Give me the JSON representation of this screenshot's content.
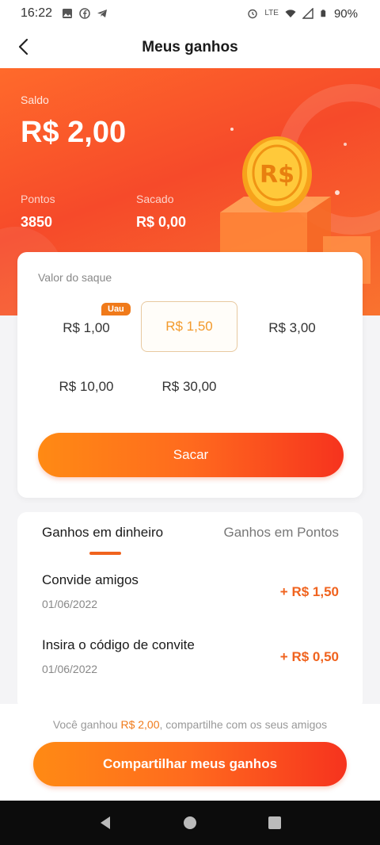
{
  "status": {
    "time": "16:22",
    "battery": "90%",
    "network": "LTE"
  },
  "header": {
    "title": "Meus ganhos"
  },
  "balance": {
    "saldo_label": "Saldo",
    "saldo_value": "R$ 2,00",
    "pontos_label": "Pontos",
    "pontos_value": "3850",
    "sacado_label": "Sacado",
    "sacado_value": "R$ 0,00"
  },
  "withdraw": {
    "label": "Valor do saque",
    "badge": "Uau",
    "options": [
      "R$ 1,00",
      "R$ 1,50",
      "R$ 3,00",
      "R$ 10,00",
      "R$ 30,00"
    ],
    "selected": "R$ 1,50",
    "button": "Sacar"
  },
  "earnings": {
    "tabs": [
      "Ganhos em dinheiro",
      "Ganhos em Pontos"
    ],
    "active_tab": "Ganhos em dinheiro",
    "rows": [
      {
        "title": "Convide amigos",
        "date": "01/06/2022",
        "amount": "+ R$ 1,50"
      },
      {
        "title": "Insira o código de convite",
        "date": "01/06/2022",
        "amount": "+ R$ 0,50"
      }
    ]
  },
  "share": {
    "text_before": "Você ganhou ",
    "text_highlight": "R$ 2,00",
    "text_after": ", compartilhe com os seus amigos",
    "button": "Compartilhar meus ganhos"
  },
  "colors": {
    "accent": "#f0631e",
    "selected_text": "#f39a2c",
    "hero": "#f64a2a"
  }
}
